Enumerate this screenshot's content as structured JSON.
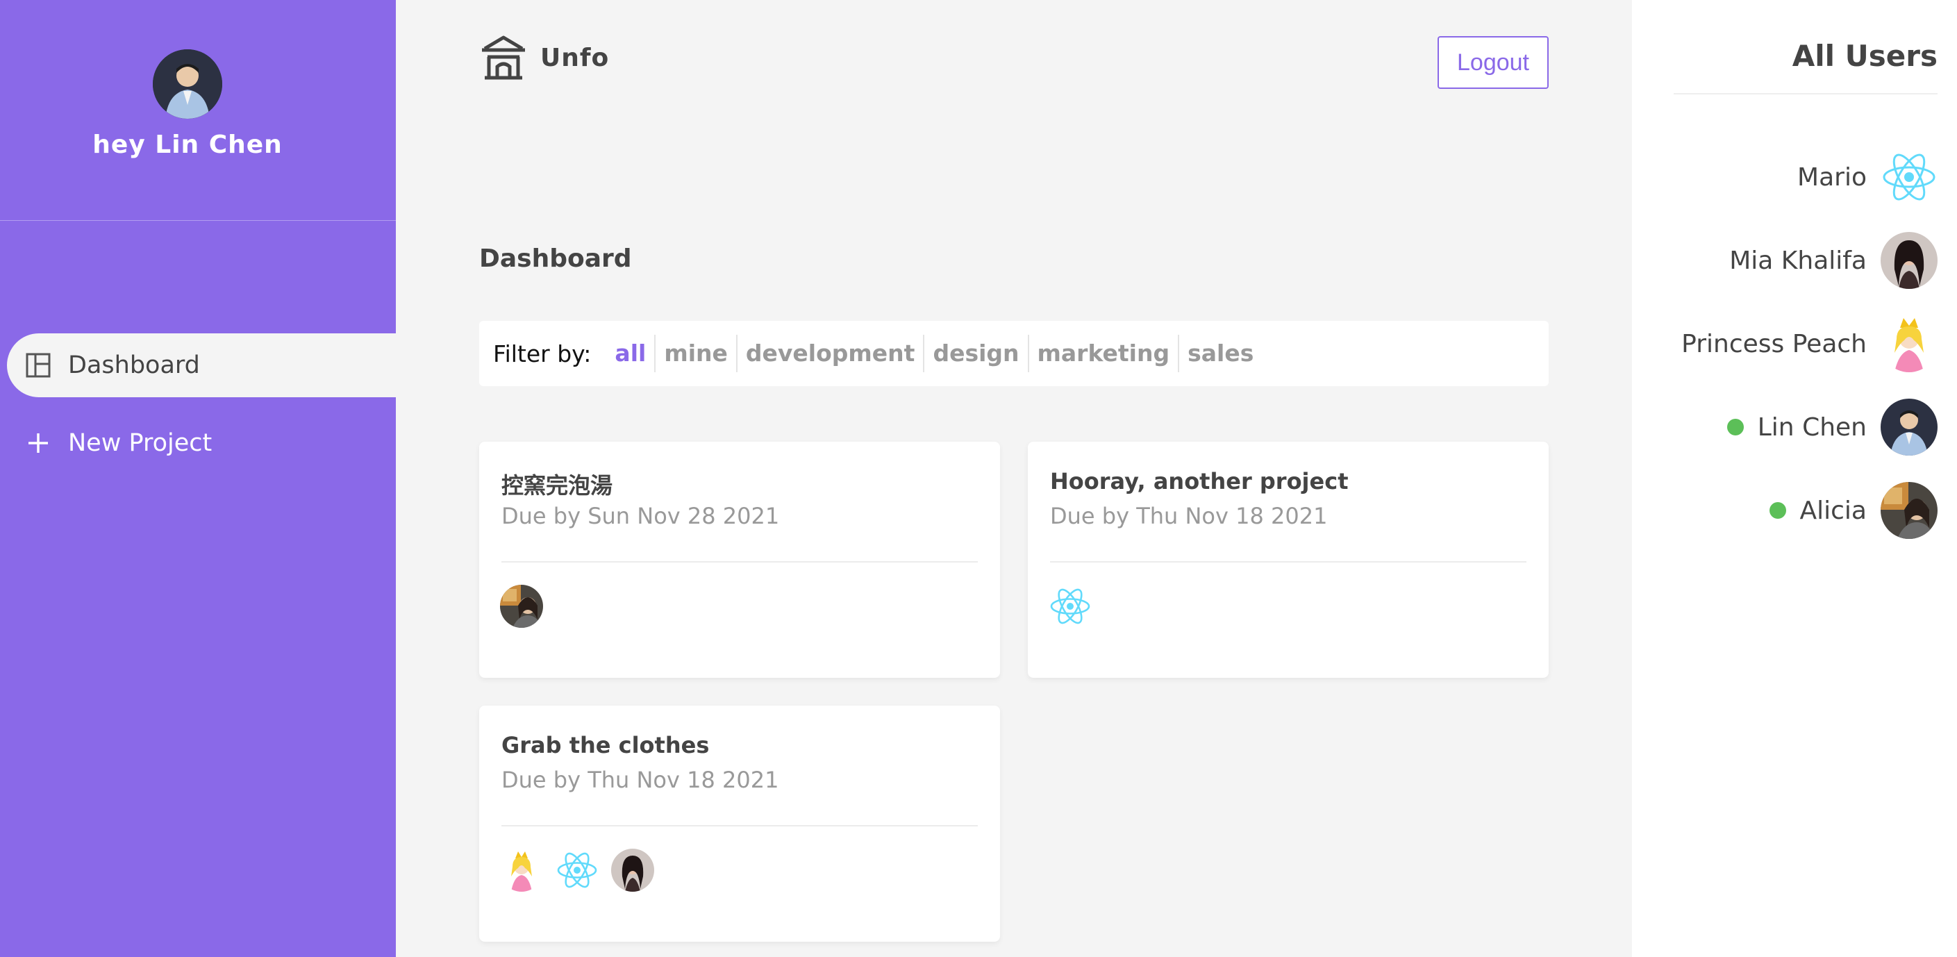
{
  "sidebar": {
    "greeting": "hey Lin Chen",
    "avatar_icon": "person-photo-avatar",
    "nav": [
      {
        "label": "Dashboard",
        "icon": "dashboard-layout-icon",
        "active": true
      },
      {
        "label": "New Project",
        "icon": "plus-icon",
        "active": false
      }
    ]
  },
  "header": {
    "brand": "Unfo",
    "brand_icon": "temple-icon",
    "logout_label": "Logout"
  },
  "main": {
    "title": "Dashboard",
    "filter": {
      "label": "Filter by:",
      "options": [
        "all",
        "mine",
        "development",
        "design",
        "marketing",
        "sales"
      ],
      "selected": "all"
    },
    "projects": [
      {
        "title": "控窯完泡湯",
        "due": "Due by Sun Nov 28 2021",
        "assigned": [
          "Alicia"
        ]
      },
      {
        "title": "Hooray, another project",
        "due": "Due by Thu Nov 18 2021",
        "assigned": [
          "Mario"
        ]
      },
      {
        "title": "Grab the clothes",
        "due": "Due by Thu Nov 18 2021",
        "assigned": [
          "Princess Peach",
          "Mario",
          "Mia Khalifa"
        ]
      }
    ]
  },
  "users_panel": {
    "title": "All Users",
    "users": [
      {
        "name": "Mario",
        "online": false,
        "avatar": "react-logo-avatar"
      },
      {
        "name": "Mia Khalifa",
        "online": false,
        "avatar": "person-photo-avatar"
      },
      {
        "name": "Princess Peach",
        "online": false,
        "avatar": "princess-avatar"
      },
      {
        "name": "Lin Chen",
        "online": true,
        "avatar": "person-photo-avatar"
      },
      {
        "name": "Alicia",
        "online": true,
        "avatar": "person-photo-avatar"
      }
    ]
  },
  "colors": {
    "accent": "#8a69e8",
    "online": "#5cbf58",
    "background": "#f4f4f4",
    "react": "#61dafb"
  }
}
